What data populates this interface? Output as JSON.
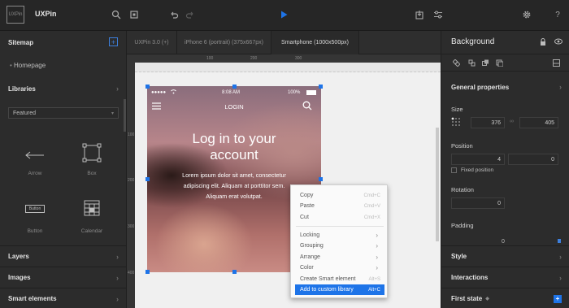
{
  "app": {
    "logo": "UXPin",
    "name": "UXPin"
  },
  "toolbar": {
    "icons": [
      "search-icon",
      "crop-icon",
      "undo-icon",
      "redo-icon",
      "play-icon",
      "export-icon",
      "settings-sliders-icon",
      "gear-icon",
      "help-icon"
    ],
    "help_label": "?"
  },
  "left_panel": {
    "sitemap_title": "Sitemap",
    "sitemap_add": "+",
    "pages": [
      "Homepage"
    ],
    "libraries_title": "Libraries",
    "library_select": "Featured",
    "library_items": [
      "Arrow",
      "Box",
      "Button",
      "Calendar"
    ],
    "button_preview_label": "Button",
    "bottom_sections": [
      "Layers",
      "Images",
      "Smart elements"
    ]
  },
  "tabs": [
    "UXPin 3.0 (+)",
    "iPhone 6 (portrait) (375x667px)",
    "Smartphone (1000x500px)"
  ],
  "rulers": {
    "horizontal": [
      "100",
      "200",
      "300"
    ],
    "vertical": [
      "100",
      "200",
      "300",
      "400"
    ]
  },
  "phone": {
    "carrier": "●●●●● ",
    "time": "8:08 AM",
    "battery": "100%",
    "nav_title": "LOGIN",
    "headline_1": "Log in to your",
    "headline_2": "account",
    "body_1": "Lorem ipsum dolor sit amet, consectetur",
    "body_2": "adipiscing elit. Aliquam at porttitor sem.",
    "body_3": "Aliquam erat volutpat."
  },
  "context_menu": {
    "items": [
      {
        "label": "Copy",
        "shortcut": "Cmd+C"
      },
      {
        "label": "Paste",
        "shortcut": "Cmd+V"
      },
      {
        "label": "Cut",
        "shortcut": "Cmd+X"
      },
      {
        "label": "Locking",
        "arrow": "›"
      },
      {
        "label": "Grouping",
        "arrow": "›"
      },
      {
        "label": "Arrange",
        "arrow": "›"
      },
      {
        "label": "Color",
        "arrow": "›"
      },
      {
        "label": "Create Smart element",
        "shortcut": "Alt+S"
      },
      {
        "label": "Add to custom library",
        "shortcut": "Alt+C"
      }
    ]
  },
  "right_panel": {
    "title": "Background",
    "general_properties": "General properties",
    "size_label": "Size",
    "width": "376",
    "height": "405",
    "position_label": "Position",
    "pos_x": "4",
    "pos_y": "0",
    "fixed_position": "Fixed position",
    "rotation_label": "Rotation",
    "rotation": "0",
    "padding_label": "Padding",
    "padding": "0",
    "sections": [
      "Style",
      "Interactions",
      "First state"
    ],
    "first_state_add": "+"
  },
  "colors": {
    "accent": "#1e74e8",
    "panel": "#2c2c2c",
    "canvas": "#f0f0f0"
  }
}
